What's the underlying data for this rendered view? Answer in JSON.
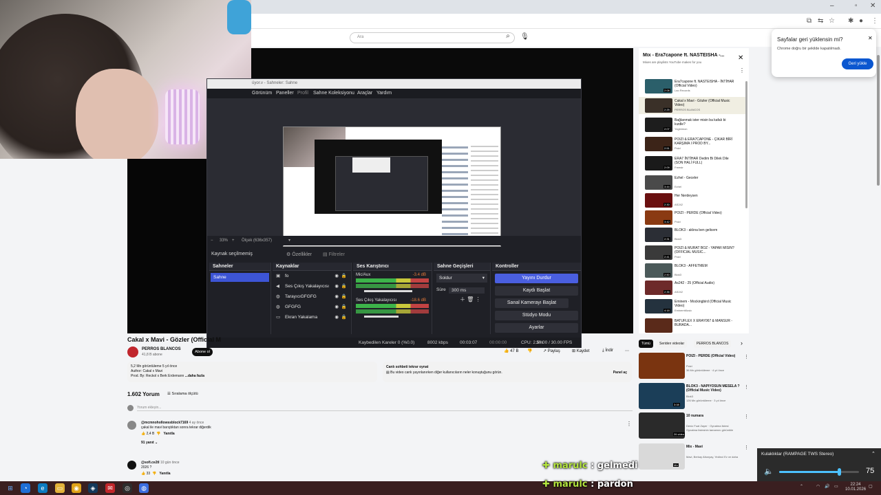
{
  "search": {
    "placeholder": "Ara"
  },
  "obs": {
    "window_title": "üyor.v - Sahneler: Sahne",
    "menu": [
      "Görünüm",
      "Paneller",
      "Profil",
      "Sahne Koleksiyonu",
      "Araçlar",
      "Yardım"
    ],
    "zoom": "33%",
    "canvas": "Ölçek (636x357)",
    "no_source": "Kaynak seçilmemiş",
    "properties": "Özellikler",
    "filters": "Filtreler",
    "docks": {
      "scenes": "Sahneler",
      "sources": "Kaynaklar",
      "mixer": "Ses Karıştırıcı",
      "transitions": "Sahne Geçişleri",
      "controls": "Kontroller"
    },
    "scenes": [
      "Sahne"
    ],
    "sources": [
      "fo",
      "Ses Çıkış Yakalayıcısı",
      "TarayıcıGFGFG",
      "GFGFG",
      "Ekran Yakalama"
    ],
    "mixer": [
      {
        "name": "Mic/Aux",
        "db": "-3.4 dB"
      },
      {
        "name": "Ses Çıkış Yakalayıcısı",
        "db": "-18.6 dB"
      }
    ],
    "transition": "Soldur",
    "duration_label": "Süre",
    "duration": "300 ms",
    "controls": [
      "Yayını Durdur",
      "Kaydı Başlat",
      "Sanal Kamerayı Başlat",
      "Stüdyo Modu",
      "Ayarlar"
    ],
    "status": {
      "dropped": "Kaybedilen Kareler 0 (%0.0)",
      "bitrate": "8002 kbps",
      "live_time": "00:03:07",
      "rec_time": "00:00:00",
      "cpu": "CPU: 2.5%",
      "fps": "30.00 / 30.00 FPS"
    }
  },
  "video": {
    "title": "Cakal x Mavi - Gözler (Official M",
    "channel": "PERROS BLANCOS",
    "subs": "41,8 B abone",
    "subscribe": "Abone ol",
    "likes": "47 B",
    "share": "Paylaş",
    "save": "Kaydet",
    "download": "İndir",
    "description": {
      "line1": "5,2 Mn görüntüleme  5 yıl önce",
      "line2": "Author: Cakal x Mavi",
      "line3": "Prod. By: Reckol x Berk Erdemann",
      "more": "...daha fazla"
    },
    "chat_replay": "Canlı sohbeti tekrar oynat",
    "chat_replay_desc": "Bu video canlı yayınlanırken diğer kullanıcıların neler konuştuğunu görün.",
    "chat_open": "Panel aç"
  },
  "comments": {
    "count": "1.602 Yorum",
    "sort": "Sıralama ölçütü",
    "add": "Yorum ekleyin...",
    "items": [
      {
        "user": "@mcmnohollowssblock7169",
        "time": "4 ay önce",
        "text": "çakal ile mavi barıştıktan sonra tekrar diğerdik",
        "likes": "2,4 B",
        "reply": "Yanıtla",
        "replies": "91 yanıt"
      },
      {
        "user": "@sofi.ce2tl",
        "time": "10 gün önce",
        "text": "2026 ?",
        "likes": "33",
        "reply": "Yanıtla"
      }
    ]
  },
  "playlist": {
    "title": "Mix - Era7capone ft. NASTEISHA -...",
    "subtitle": "Mixes are playlists YouTube makes for you",
    "items": [
      {
        "title": "Era7capone ft. NASTEISHA - İNTİHAR (Official Video)",
        "channel": "Lao Records",
        "duration": "2:08",
        "color": "#2b5f6a"
      },
      {
        "title": "Cakal x Mavi - Gözler (Official Music Video)",
        "channel": "PERROS BLANCOS",
        "duration": "2:25",
        "color": "#3a3028"
      },
      {
        "title": "Bağlanmak ister misin ba kafalı bi kızdle?",
        "channel": "Yoginimon",
        "duration": "2:07",
        "color": "#1d1d1d"
      },
      {
        "title": "POIZI & ERA7CAPONE - ÇIKAR BİRİ KARŞIMA I PROD BY...",
        "channel": "Poizi",
        "duration": "2:51",
        "color": "#3c2418"
      },
      {
        "title": "ERA7 İNTİHAR Dedim Bi Dilek Dile (SON HALİ FULL)",
        "channel": "Freestr",
        "duration": "2:09",
        "color": "#1a1a1a"
      },
      {
        "title": "Ezhel - Geceler",
        "channel": "Ezhel",
        "duration": "3:44",
        "color": "#4a4a4a"
      },
      {
        "title": "Her Nerdeysen",
        "channel": "AS242",
        "duration": "2:30",
        "color": "#6a1010"
      },
      {
        "title": "POIZI - PERDE (Official Video)",
        "channel": "Poizi",
        "duration": "3:42",
        "color": "#8a3a12"
      },
      {
        "title": "BLOK3 - aklına ben gelicem",
        "channel": "Blok3",
        "duration": "2:31",
        "color": "#2b2e35"
      },
      {
        "title": "POIZI & MURAT BOZ - YAPAR MISIN? (OFFICIAL MUSIC...",
        "channel": "Poizi",
        "duration": "2:41",
        "color": "#3a3a3a"
      },
      {
        "title": "BLOK3 - AFFETMEM",
        "channel": "Blok3",
        "duration": "2:50",
        "color": "#4b5a5a"
      },
      {
        "title": "As242 - 25 (Official Audio)",
        "channel": "AS242",
        "duration": "2:35",
        "color": "#6d2a2a"
      },
      {
        "title": "Eminem - Mockingbird (Official Music Video)",
        "channel": "EminemMusic",
        "duration": "4:18",
        "color": "#24323e"
      },
      {
        "title": "BATUFLEX X ERAY067 & MANSUR - BURADA...",
        "channel": "",
        "duration": "",
        "color": "#5a2a1a"
      }
    ]
  },
  "recommendations": {
    "chips": [
      "Tümü",
      "Seriden videolar",
      "PERROS BLANCOS",
      "İ"
    ],
    "items": [
      {
        "title": "POIZI - PERDE (Official Video)",
        "channel": "Poizi",
        "meta": "36 Mn görüntüleme · 4 yıl önce",
        "duration": "",
        "color": "#7a3410"
      },
      {
        "title": "BLOK3 - NAPIYOSUN MESELA ? (Official Music Video)",
        "channel": "Blok3",
        "meta": "126 Mn görüntüleme · 3 yıl önce",
        "duration": "3:08",
        "color": "#1b3e58"
      },
      {
        "title": "10 numara",
        "channel": "Deniz Fuat Zayer · Oynatma listesi",
        "meta": "Oynatma listesinin tamamını görüntüle",
        "duration": "26 video",
        "color": "#2a2a2a"
      },
      {
        "title": "Mix - Mavi",
        "channel": "Mavi, Berkay Altunyay, Yedinci Ev ve daha",
        "meta": "",
        "duration": "Mix",
        "color": "#d9d9d9"
      }
    ]
  },
  "popup": {
    "title": "Sayfalar geri yüklensin mi?",
    "message": "Chrome doğru bir şekilde kapatılmadı.",
    "button": "Geri yükle"
  },
  "volume": {
    "device": "Kulaklıklar (RAMPAGE TWS Stereo)",
    "value": "75",
    "level": 0.75
  },
  "chat_overlay": [
    {
      "user": "marulc",
      "message": ": gelmedi"
    },
    {
      "user": "marulc",
      "message": ": pardon"
    }
  ],
  "clock": {
    "time": "22:24",
    "date": "10.01.2026"
  },
  "colors": {
    "accent": "#4a5fe0",
    "chat_user": "#b4e53f",
    "chrome_blue": "#0b57d0"
  }
}
